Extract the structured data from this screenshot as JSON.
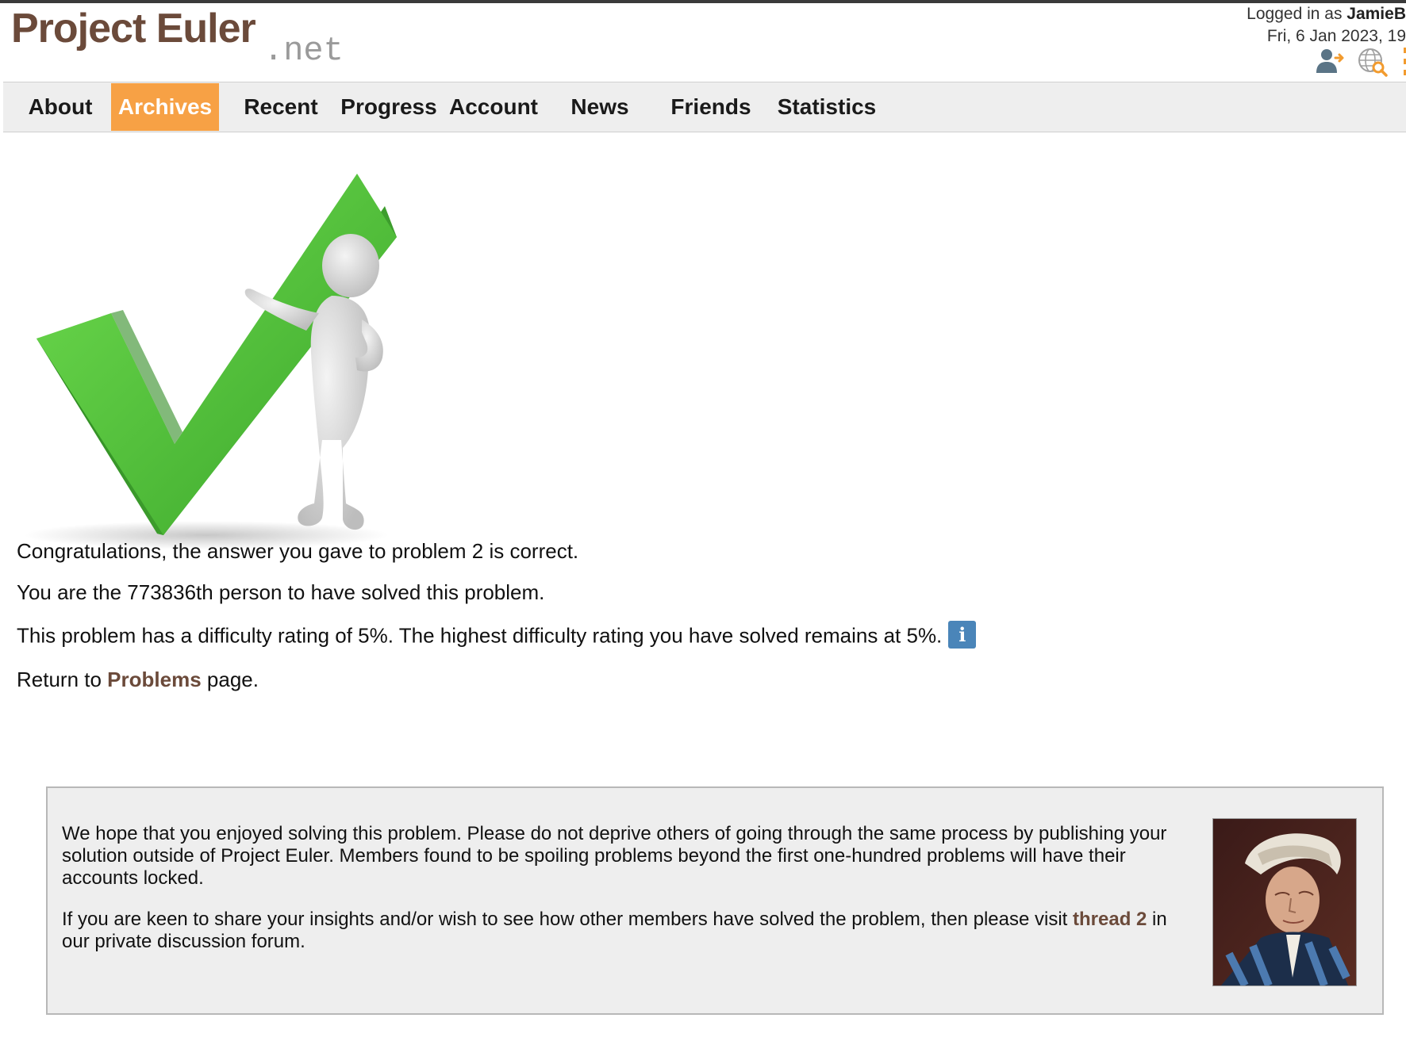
{
  "header": {
    "logo_main": "Project Euler",
    "logo_sub": ".net",
    "logged_in_prefix": "Logged in as ",
    "username": "JamieB",
    "datetime": "Fri, 6 Jan 2023, 19"
  },
  "icons": {
    "account_icon": "user-arrow-icon",
    "search_icon": "globe-search-icon",
    "menu_icon": "menu-dots-icon"
  },
  "nav": {
    "items": [
      {
        "label": "About",
        "active": false
      },
      {
        "label": "Archives",
        "active": true
      },
      {
        "label": "Recent",
        "active": false
      },
      {
        "label": "Progress",
        "active": false
      },
      {
        "label": "Account",
        "active": false
      },
      {
        "label": "News",
        "active": false
      },
      {
        "label": "Friends",
        "active": false
      },
      {
        "label": "Statistics",
        "active": false
      }
    ]
  },
  "messages": {
    "congrats": "Congratulations, the answer you gave to problem 2 is correct.",
    "solver_rank": "You are the 773836th person to have solved this problem.",
    "difficulty": "This problem has a difficulty rating of 5%. The highest difficulty rating you have solved remains at 5%.",
    "info_glyph": "i",
    "return_prefix": "Return to ",
    "return_link": "Problems",
    "return_suffix": " page."
  },
  "note": {
    "paragraph1": "We hope that you enjoyed solving this problem. Please do not deprive others of going through the same process by publishing your solution outside of Project Euler. Members found to be spoiling problems beyond the first one-hundred problems will have their accounts locked.",
    "paragraph2_prefix": "If you are keen to share your insights and/or wish to see how other members have solved the problem, then please visit ",
    "paragraph2_link": "thread 2",
    "paragraph2_suffix": " in our private discussion forum."
  },
  "colors": {
    "brand_brown": "#6b4a3a",
    "active_tab": "#f7a145",
    "info_blue": "#4a85b9",
    "check_green": "#4cb83a"
  }
}
